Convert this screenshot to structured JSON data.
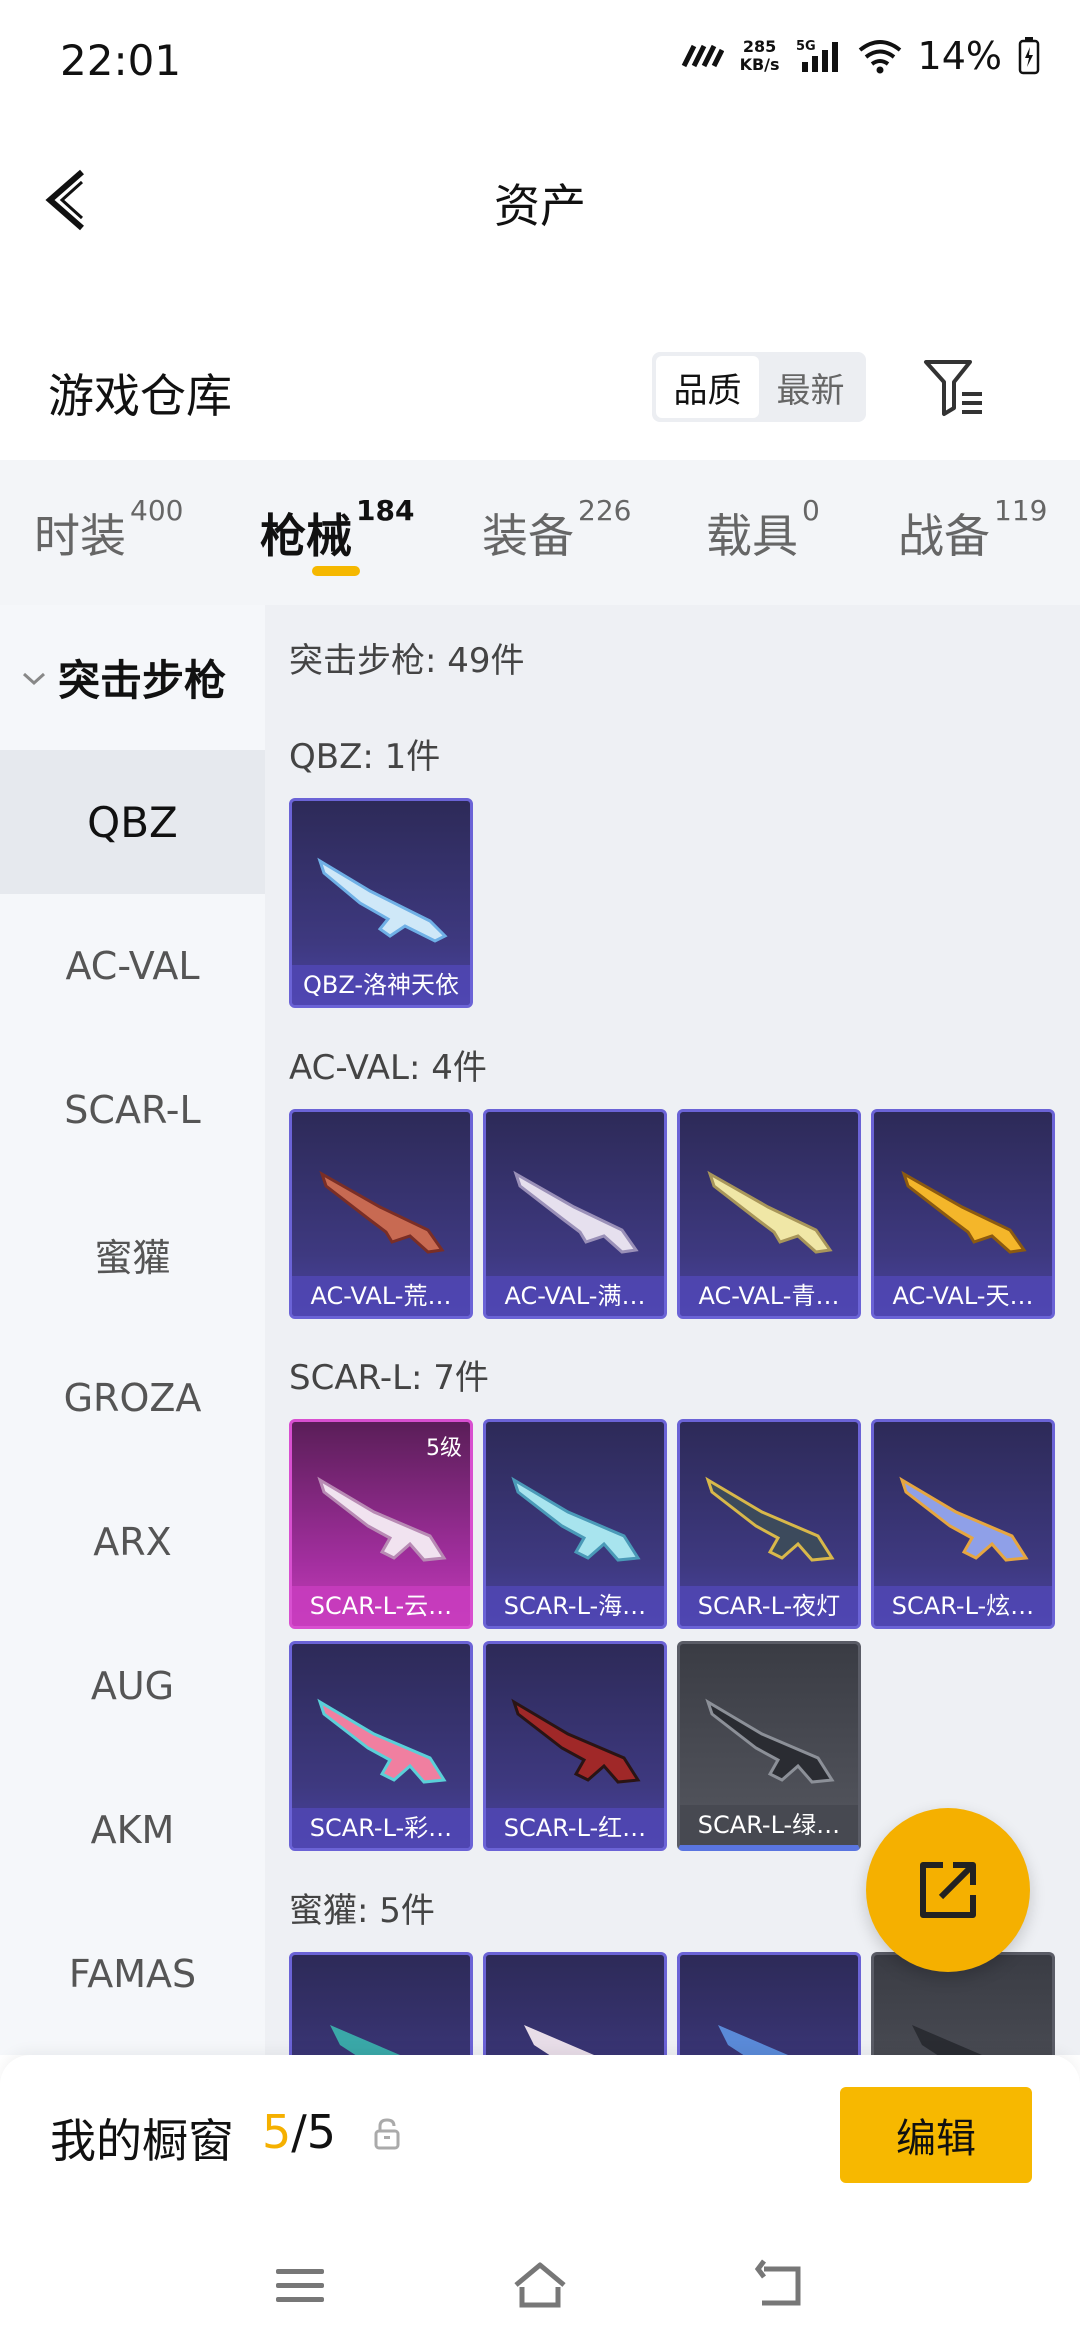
{
  "status_bar": {
    "time": "22:01",
    "speed_value": "285",
    "speed_unit": "KB/s",
    "network": "5G",
    "battery": "14%"
  },
  "header": {
    "title": "资产"
  },
  "warehouse": {
    "title": "游戏仓库",
    "sort_options": [
      "品质",
      "最新"
    ],
    "active_sort": "品质"
  },
  "tabs": [
    {
      "label": "时装",
      "count": "400"
    },
    {
      "label": "枪械",
      "count": "184"
    },
    {
      "label": "装备",
      "count": "226"
    },
    {
      "label": "载具",
      "count": "0"
    },
    {
      "label": "战备",
      "count": "119"
    }
  ],
  "active_tab": "枪械",
  "sidebar": {
    "category": "突击步枪",
    "items": [
      "QBZ",
      "AC-VAL",
      "SCAR-L",
      "蜜獾",
      "GROZA",
      "ARX",
      "AUG",
      "AKM",
      "FAMAS"
    ],
    "active": "QBZ"
  },
  "content": {
    "summary": "突击步枪: 49件",
    "sections": [
      {
        "title": "QBZ: 1件",
        "items": [
          {
            "name": "QBZ-洛神天依"
          }
        ]
      },
      {
        "title": "AC-VAL: 4件",
        "items": [
          {
            "name": "AC-VAL-荒…"
          },
          {
            "name": "AC-VAL-满…"
          },
          {
            "name": "AC-VAL-青…"
          },
          {
            "name": "AC-VAL-天…"
          }
        ]
      },
      {
        "title": "SCAR-L: 7件",
        "items": [
          {
            "name": "SCAR-L-云…",
            "level": "5级"
          },
          {
            "name": "SCAR-L-海…"
          },
          {
            "name": "SCAR-L-夜灯"
          },
          {
            "name": "SCAR-L-炫…"
          },
          {
            "name": "SCAR-L-彩…"
          },
          {
            "name": "SCAR-L-红…"
          },
          {
            "name": "SCAR-L-绿…"
          }
        ]
      },
      {
        "title": "蜜獾: 5件",
        "items": []
      }
    ]
  },
  "showcase": {
    "title": "我的橱窗",
    "current": "5",
    "total": "/5",
    "edit_label": "编辑"
  },
  "colors": {
    "accent": "#f5b000",
    "card_blue": "#3e3980",
    "card_pink": "#a42fa0",
    "card_gray": "#55575f"
  }
}
